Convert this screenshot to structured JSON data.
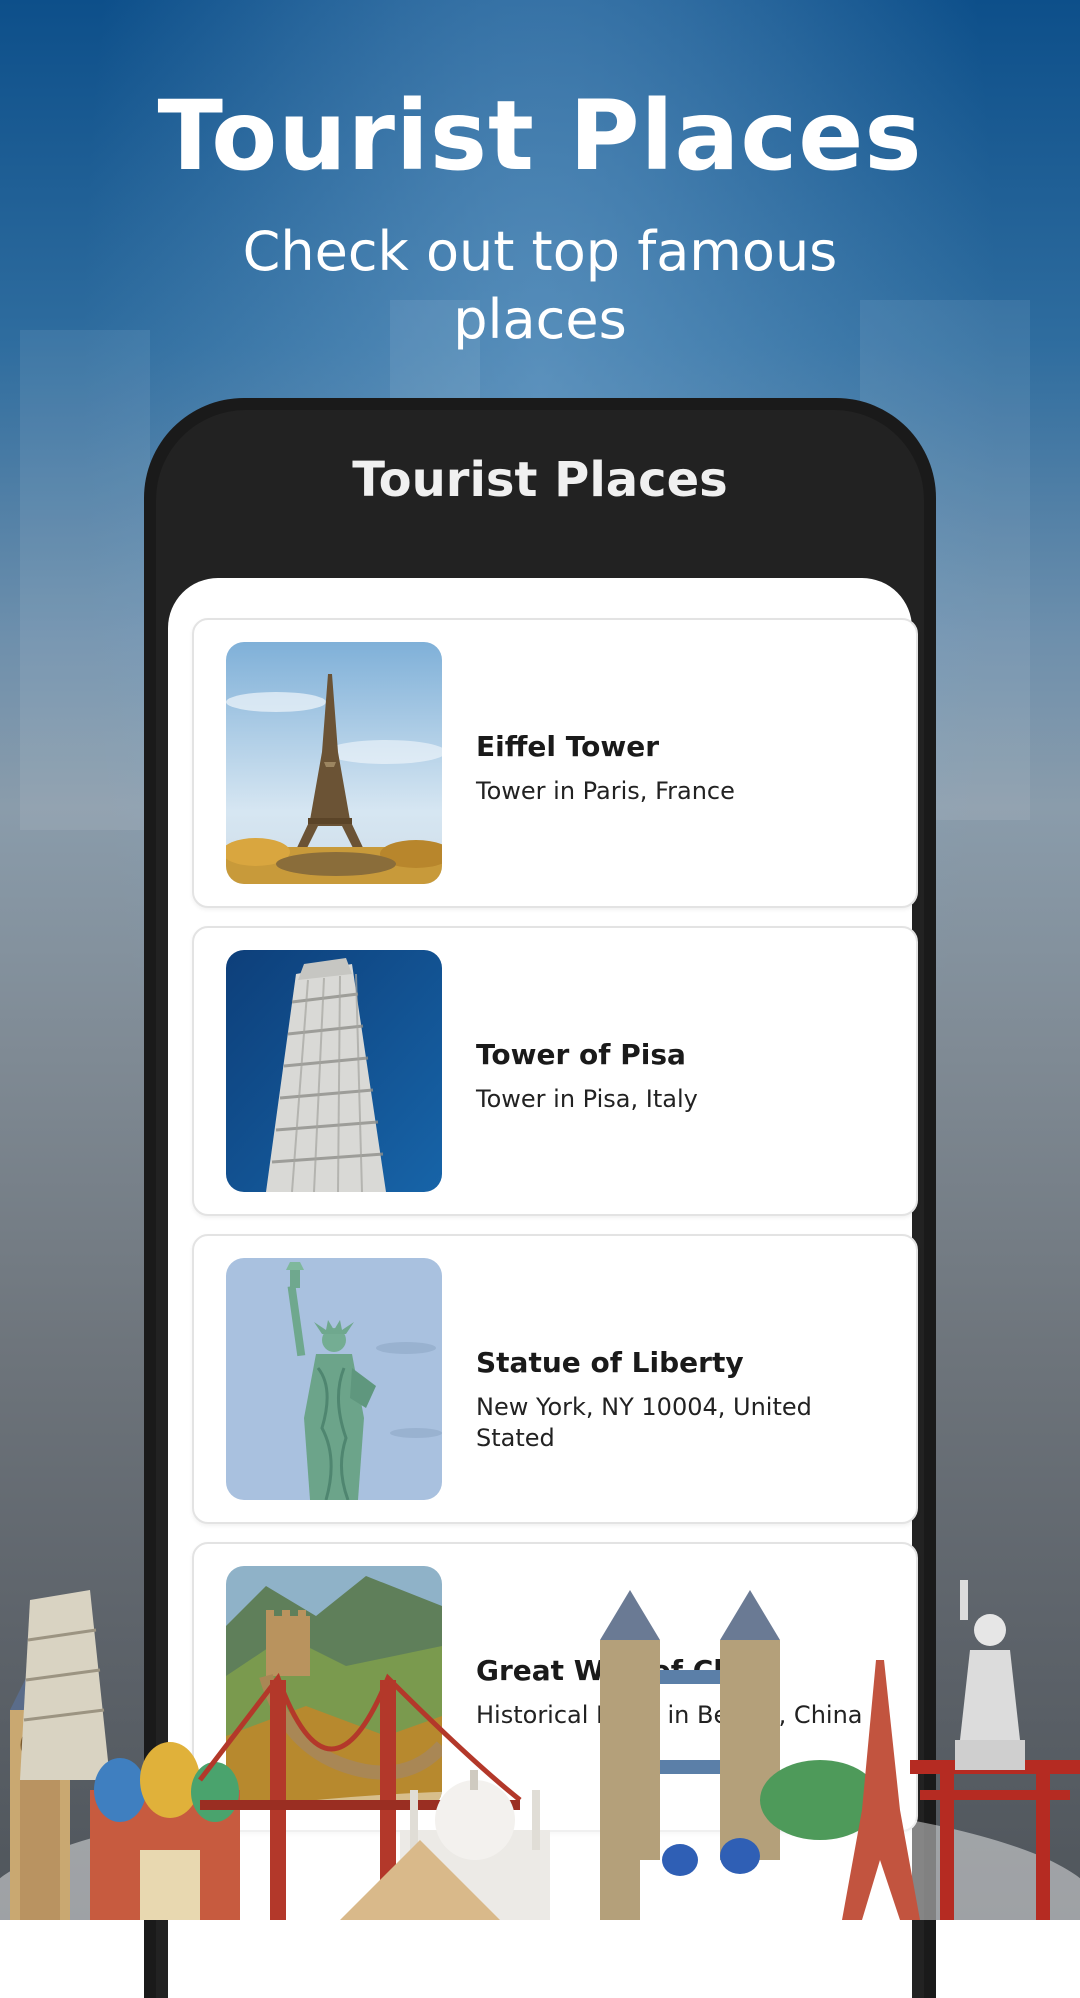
{
  "hero": {
    "title": "Tourist Places",
    "subtitle": "Check out top famous places"
  },
  "app": {
    "title": "Tourist Places"
  },
  "places": [
    {
      "name": "Eiffel Tower",
      "location": "Tower in Paris, France"
    },
    {
      "name": "Tower of Pisa",
      "location": "Tower in Pisa, Italy"
    },
    {
      "name": "Statue of Liberty",
      "location": "New York, NY 10004, United Stated"
    },
    {
      "name": "Great Wall of China",
      "location": "Historical Place in Beijing, China"
    }
  ],
  "colors": {
    "background_top": "#0d4f8a",
    "phone_frame": "#1a1a1a",
    "card_border": "#e3e3e3"
  }
}
